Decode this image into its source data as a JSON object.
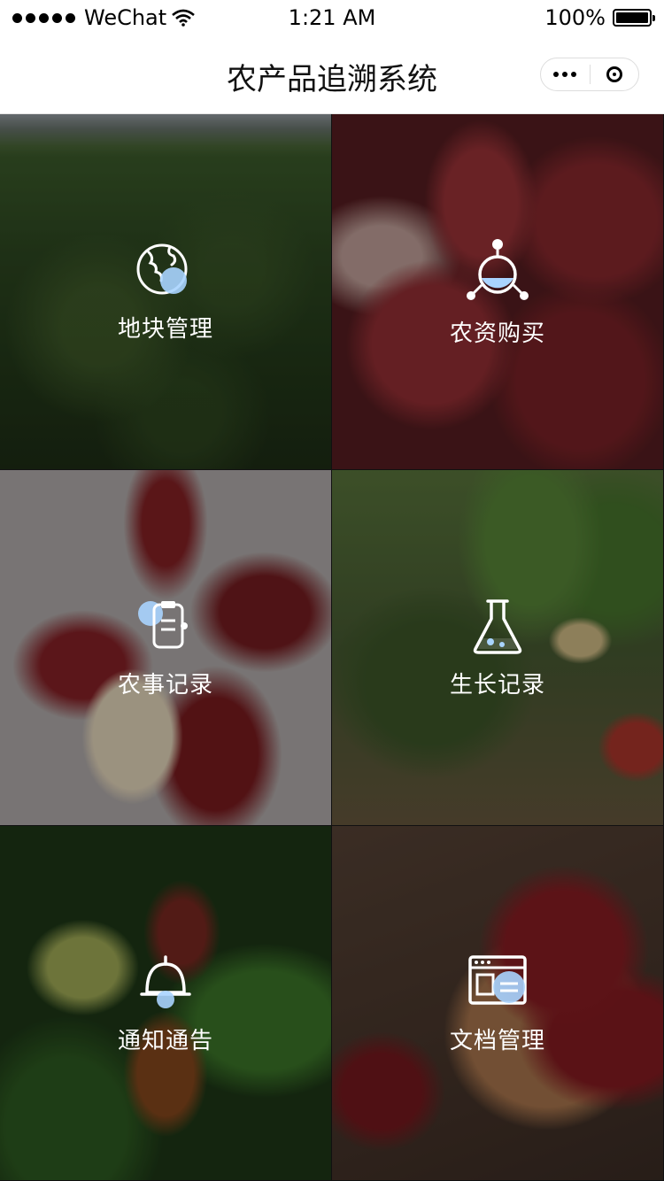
{
  "status_bar": {
    "carrier": "WeChat",
    "time": "1:21 AM",
    "battery": "100%"
  },
  "nav": {
    "title": "农产品追溯系统"
  },
  "menu": [
    {
      "label": "地块管理",
      "icon": "globe-icon"
    },
    {
      "label": "农资购买",
      "icon": "molecule-flask-icon"
    },
    {
      "label": "农事记录",
      "icon": "clipboard-icon"
    },
    {
      "label": "生长记录",
      "icon": "flask-icon"
    },
    {
      "label": "通知通告",
      "icon": "bell-icon"
    },
    {
      "label": "文档管理",
      "icon": "document-window-icon"
    }
  ],
  "colors": {
    "accent_bubble": "#a9d4ff",
    "label_text": "#ffffff",
    "nav_background": "#ffffff"
  }
}
